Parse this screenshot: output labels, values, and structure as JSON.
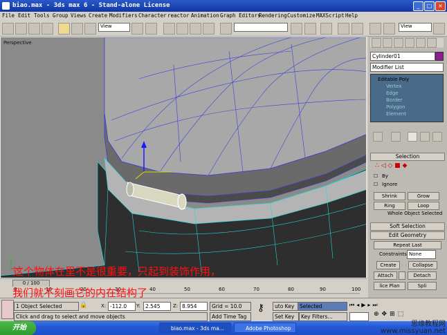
{
  "window": {
    "title": "biao.max - 3ds max 6 - Stand-alone License"
  },
  "menu": [
    "File",
    "Edit",
    "Tools",
    "Group",
    "Views",
    "Create",
    "Modifiers",
    "Character",
    "reactor",
    "Animation",
    "Graph Editors",
    "Rendering",
    "Customize",
    "MAXScript",
    "Help"
  ],
  "toolbar": {
    "view_dropdown_1": "View",
    "view_dropdown_2": "View"
  },
  "viewport": {
    "label": "Perspective"
  },
  "panel": {
    "object_name": "Cylinder01",
    "modifier_list": "Modifier List",
    "stack": [
      "Editable Poly",
      "Vertex",
      "Edge",
      "Border",
      "Polygon",
      "Element"
    ],
    "selection": {
      "title": "Selection",
      "by_label": "By",
      "ignore_label": "Ignore",
      "shrink": "Shrink",
      "grow": "Grow",
      "ring": "Ring",
      "loop": "Loop",
      "status": "Whole Object Selected"
    },
    "soft_selection": "Soft Selection",
    "edit_geometry": {
      "title": "Edit Geometry",
      "repeat_last": "Repeat Last",
      "constraints_label": "Constraints:",
      "constraints_value": "None",
      "create": "Create",
      "collapse": "Collapse",
      "attach": "Attach",
      "detach": "Detach",
      "slice_plane": "lice Plan",
      "split": "Spli"
    }
  },
  "timeline": {
    "slider": "0 / 100",
    "ticks": [
      "0",
      "10",
      "20",
      "30",
      "40",
      "50",
      "60",
      "70",
      "80",
      "90",
      "100"
    ]
  },
  "status": {
    "selected": "1 Object Selected",
    "prompt": "Click and drag to select and move objects",
    "x_label": "X:",
    "x": "-112.0",
    "y_label": "Y:",
    "y": "2.545",
    "z_label": "Z:",
    "z": "8.954",
    "grid": "Grid = 10.0",
    "add_time_tag": "Add Time Tag",
    "auto_key": "uto Key",
    "selected_dropdown": "Selected",
    "set_key": "Set Key",
    "key_filters": "Key Filters..."
  },
  "taskbar": {
    "start": "开始",
    "tasks": [
      "biao.max - 3ds ma...",
      "Adobe Photoshop"
    ]
  },
  "captions": {
    "line1": "这个物体在里不是很重要，只起到装饰作用，",
    "line2": "我们就不刻画它的内在结构了"
  },
  "watermark": {
    "line1": "思缘教程网",
    "line2": "www.missyuan.net"
  },
  "colors": {
    "title_blue": "#1a44b2",
    "selection_cyan": "#00e0e0",
    "caption_red": "#ff1010"
  }
}
